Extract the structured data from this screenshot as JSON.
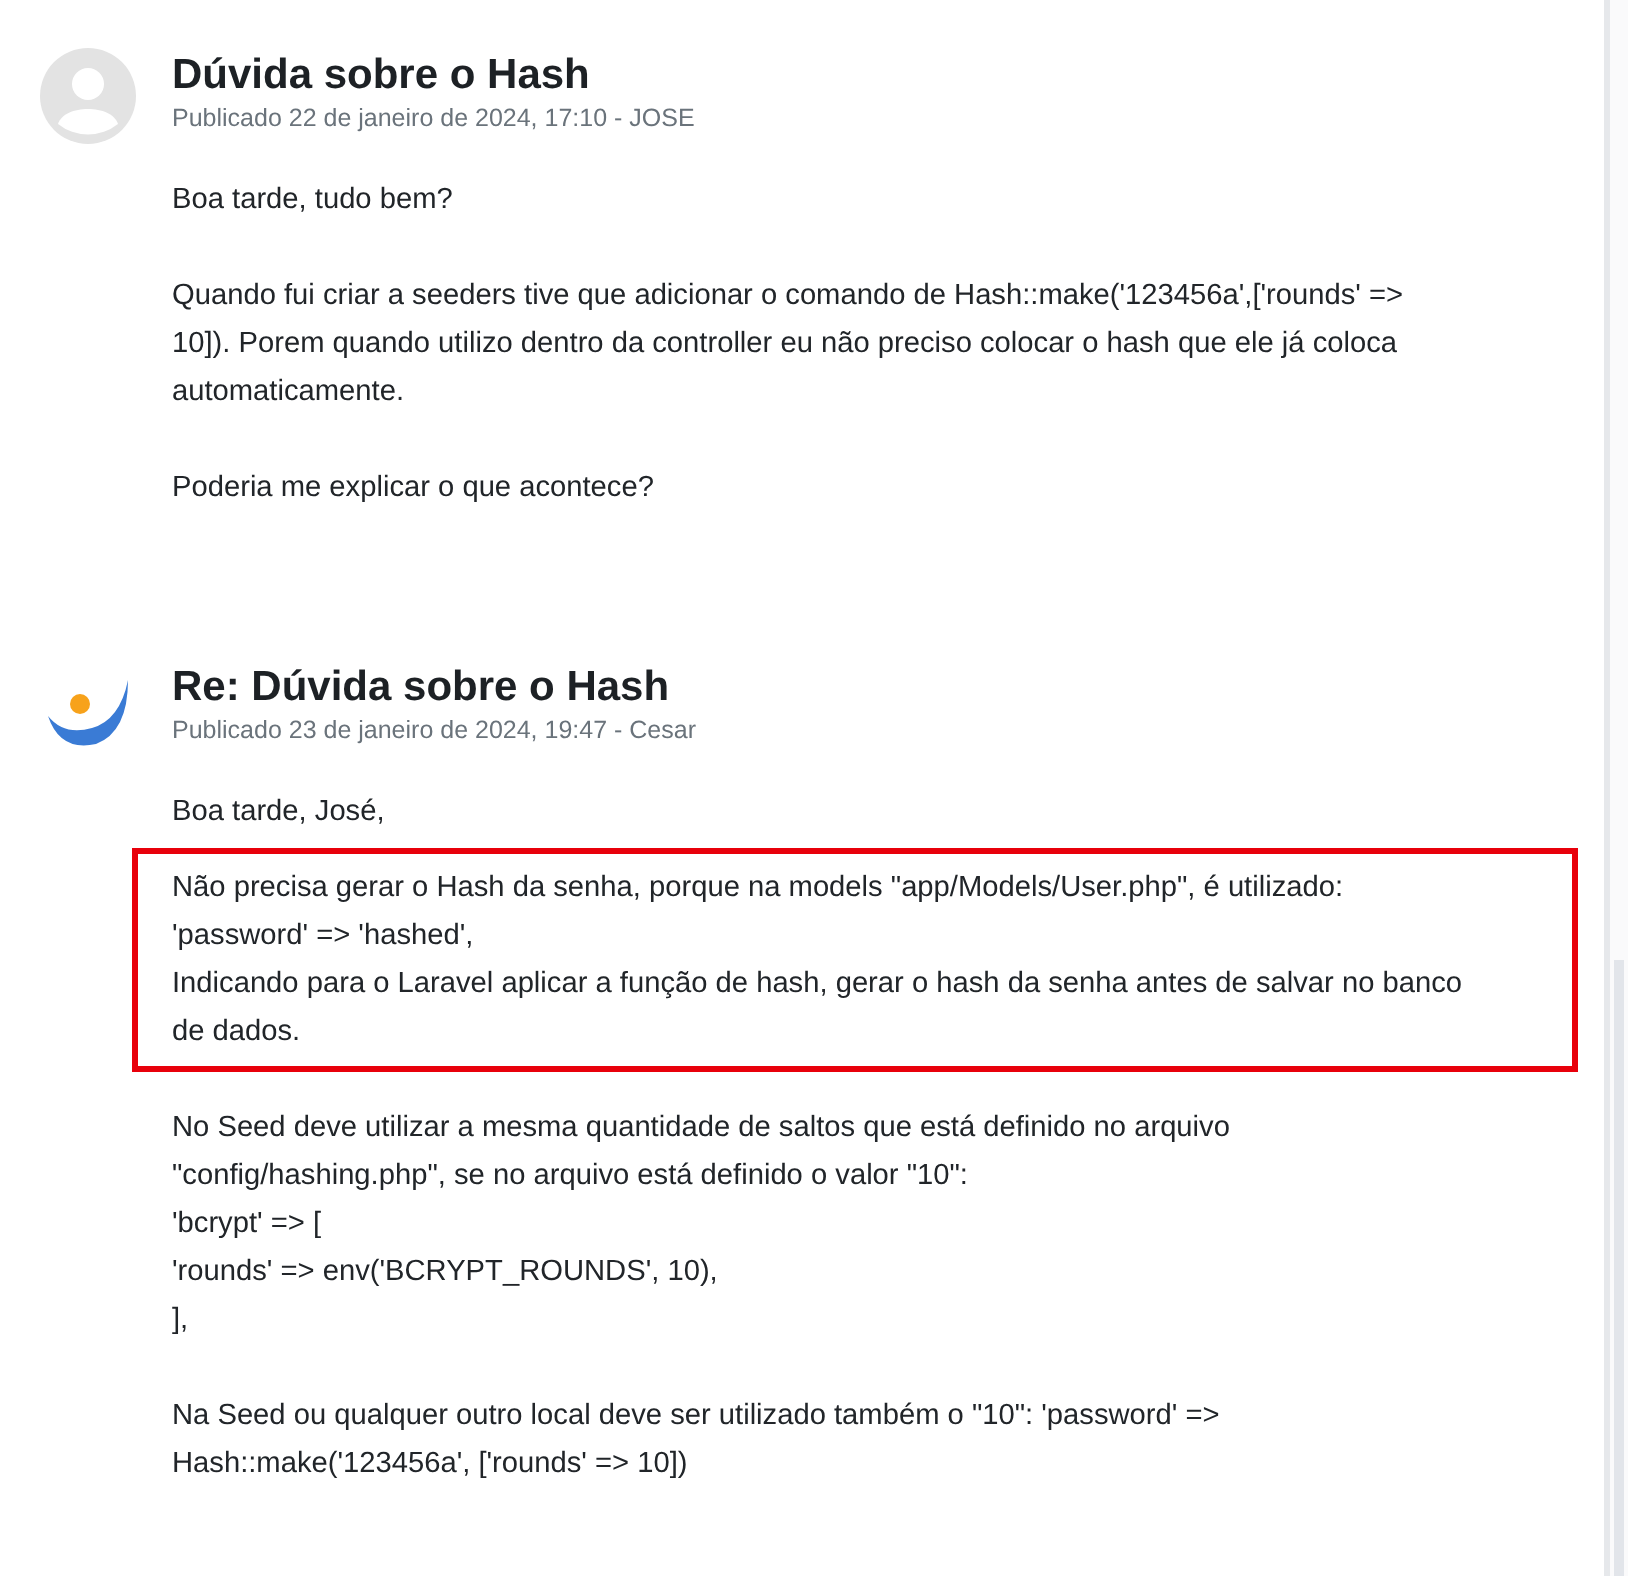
{
  "posts": [
    {
      "kind": "placeholder",
      "title": "Dúvida sobre o Hash",
      "meta": "Publicado 22 de janeiro de 2024, 17:10 - JOSE",
      "paragraphs": [
        {
          "kind": "text",
          "lines": [
            "Boa tarde, tudo bem?"
          ]
        },
        {
          "kind": "text",
          "lines": [
            "Quando fui criar a seeders tive que adicionar o comando de Hash::make('123456a',['rounds' =>",
            "10]). Porem quando utilizo dentro da controller eu não preciso colocar o hash que ele já coloca",
            "automaticamente."
          ]
        },
        {
          "kind": "text",
          "lines": [
            "Poderia me explicar o que acontece?"
          ]
        }
      ]
    },
    {
      "kind": "logo",
      "title": "Re: Dúvida sobre o Hash",
      "meta": "Publicado 23 de janeiro de 2024, 19:47 - Cesar",
      "paragraphs": [
        {
          "kind": "text",
          "lines": [
            "Boa tarde, José,"
          ]
        },
        {
          "kind": "highlight",
          "lines": [
            "Não precisa gerar o Hash da senha, porque na models \"app/Models/User.php\", é utilizado:",
            "'password' => 'hashed',",
            "Indicando para o Laravel aplicar a função de hash, gerar o hash da senha antes de salvar no banco",
            "de dados."
          ]
        },
        {
          "kind": "text",
          "lines": [
            "No Seed deve utilizar a mesma quantidade de saltos que está definido no arquivo",
            "\"config/hashing.php\", se no arquivo está definido o valor \"10\":",
            "'bcrypt' => [",
            "'rounds' => env('BCRYPT_ROUNDS', 10),",
            "],"
          ]
        },
        {
          "kind": "text",
          "lines": [
            "Na Seed ou qualquer outro local deve ser utilizado também o \"10\": 'password' =>",
            "Hash::make('123456a', ['rounds' => 10])"
          ]
        }
      ]
    }
  ]
}
